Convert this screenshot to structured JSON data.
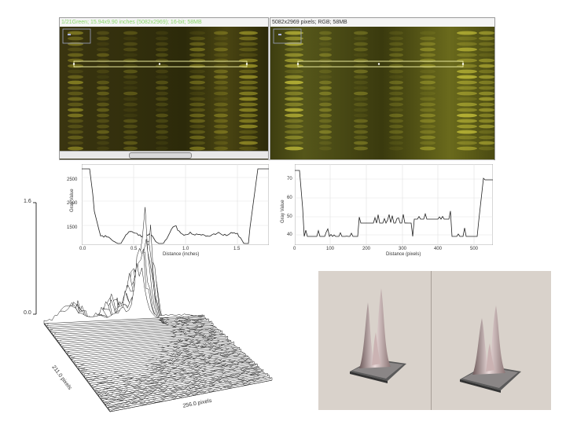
{
  "left_window": {
    "title": "1/21Green; 15.94x9.90 inches (5082x2969); 16-bit; 58MB"
  },
  "right_window": {
    "title": "5082x2969 pixels; RGB; 58MB"
  },
  "plot_left": {
    "ylabel": "Gray Value",
    "xlabel": "Distance (inches)",
    "yticks": [
      "2500",
      "2000",
      "1500"
    ],
    "xticks": [
      "0.0",
      "0.5",
      "1.0",
      "1.5"
    ]
  },
  "plot_right": {
    "ylabel": "Gray Value",
    "xlabel": "Distance (pixels)",
    "yticks": [
      "70",
      "60",
      "50",
      "40"
    ],
    "xticks": [
      "0",
      "100",
      "200",
      "300",
      "400",
      "500"
    ]
  },
  "surface": {
    "z_top": "1.6",
    "z_zero": "0.0",
    "y_axis_label": "211.0 pixels",
    "x_axis_label": "256.0 pixels"
  }
}
